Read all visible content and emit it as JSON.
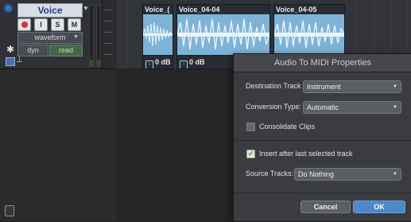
{
  "track": {
    "name": "Voice",
    "rec_icon": "record-icon",
    "input_label": "I",
    "solo_label": "S",
    "mute_label": "M",
    "view_mode": "waveform",
    "dyn_label": "dyn",
    "automation_mode": "read"
  },
  "clips": [
    {
      "name": "Voice_(",
      "gain": "0 dB"
    },
    {
      "name": "Voice_04-04",
      "gain": "0 dB"
    },
    {
      "name": "Voice_04-05",
      "gain": ""
    }
  ],
  "dialog": {
    "title": "Audio To MIDI Properties",
    "destination_label": "Destination Track Type:",
    "destination_value": "Instrument",
    "conversion_label": "Conversion Type:",
    "conversion_value": "Automatic",
    "consolidate_label": "Consolidate Clips",
    "consolidate_checked": false,
    "insert_label": "Insert after last selected track",
    "insert_checked": true,
    "source_label": "Source Tracks:",
    "source_value": "Do Nothing",
    "cancel_label": "Cancel",
    "ok_label": "OK"
  },
  "colors": {
    "clip_wave": "#7eb3d8",
    "ok_button": "#4e88c9",
    "track_name_text": "#1d3e8a",
    "read_text": "#bde7a5"
  }
}
